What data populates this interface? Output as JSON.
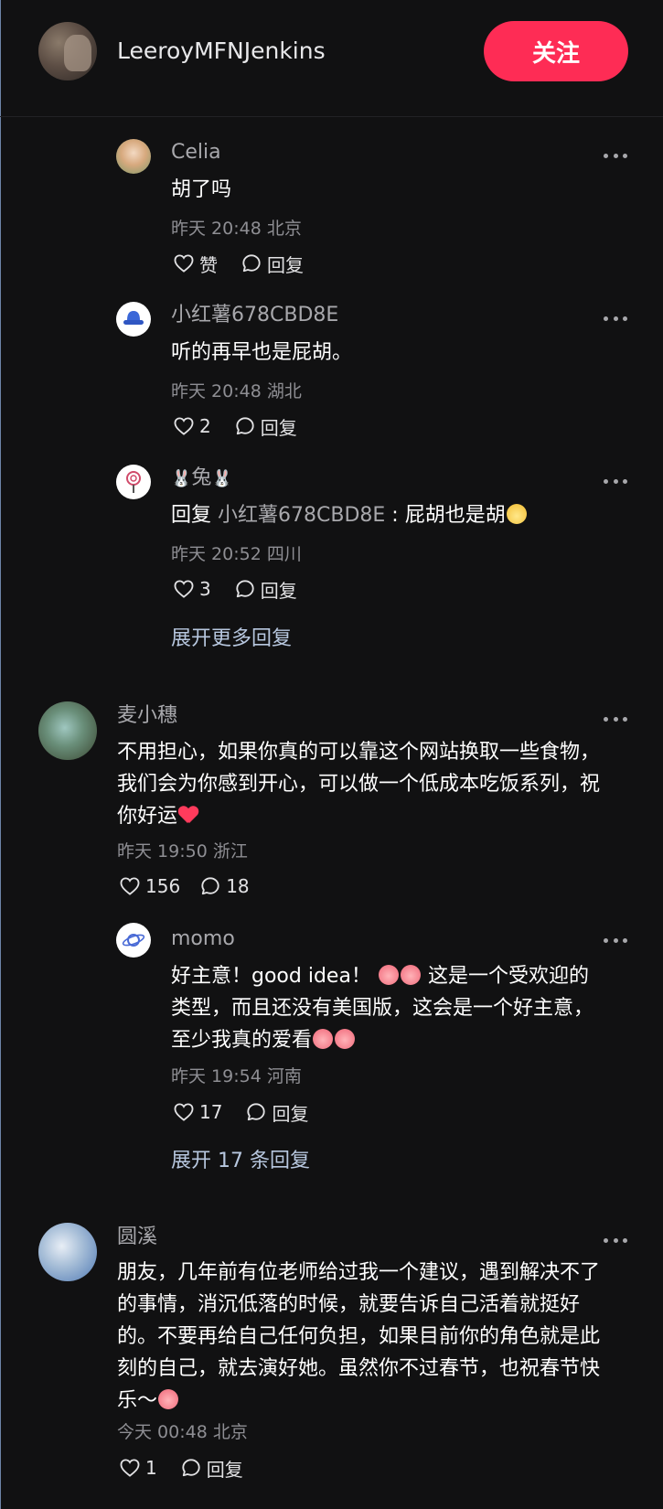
{
  "header": {
    "username": "LeeroyMFNJenkins",
    "follow_label": "关注"
  },
  "comments": [
    {
      "name": "Celia",
      "text": "胡了吗",
      "meta": "昨天 20:48 北京",
      "like_label": "赞",
      "reply_label": "回复"
    },
    {
      "name": "小红薯678CBD8E",
      "text": "听的再早也是屁胡。",
      "meta": "昨天 20:48 湖北",
      "like_count": "2",
      "reply_label": "回复"
    },
    {
      "name": "兔",
      "reply_prefix": "回复",
      "reply_target": "小红薯678CBD8E",
      "text": " : 屁胡也是胡",
      "meta": "昨天 20:52 四川",
      "like_count": "3",
      "reply_label": "回复"
    },
    {
      "expand_label": "展开更多回复"
    },
    {
      "name": "麦小穗",
      "text_line1": "不用担心，如果你真的可以靠这个网站换取一些食物，",
      "text_line2": "我们会为你感到开心，可以做一个低成本吃饭系列，祝",
      "text_line3": "你好运",
      "meta": "昨天 19:50 浙江",
      "like_count": "156",
      "reply_count": "18"
    },
    {
      "name": "momo",
      "text_line1a": "好主意！good idea！",
      "text_line1b": "这是一个受欢迎的",
      "text_line2": "类型，而且还没有美国版，这会是一个好主意，",
      "text_line3": "至少我真的爱看",
      "meta": "昨天 19:54 河南",
      "like_count": "17",
      "reply_label": "回复"
    },
    {
      "expand_label": "展开 17 条回复"
    },
    {
      "name": "圆溪",
      "text_line1": "朋友，几年前有位老师给过我一个建议，遇到解决不了",
      "text_line2": "的事情，消沉低落的时候，就要告诉自己活着就挺好",
      "text_line3": "的。不要再给自己任何负担，如果目前你的角色就是此",
      "text_line4": "刻的自己，就去演好她。虽然你不过春节，也祝春节快",
      "text_line5": "乐～",
      "meta": "今天 00:48 北京",
      "like_count": "1",
      "reply_label": "回复"
    }
  ]
}
